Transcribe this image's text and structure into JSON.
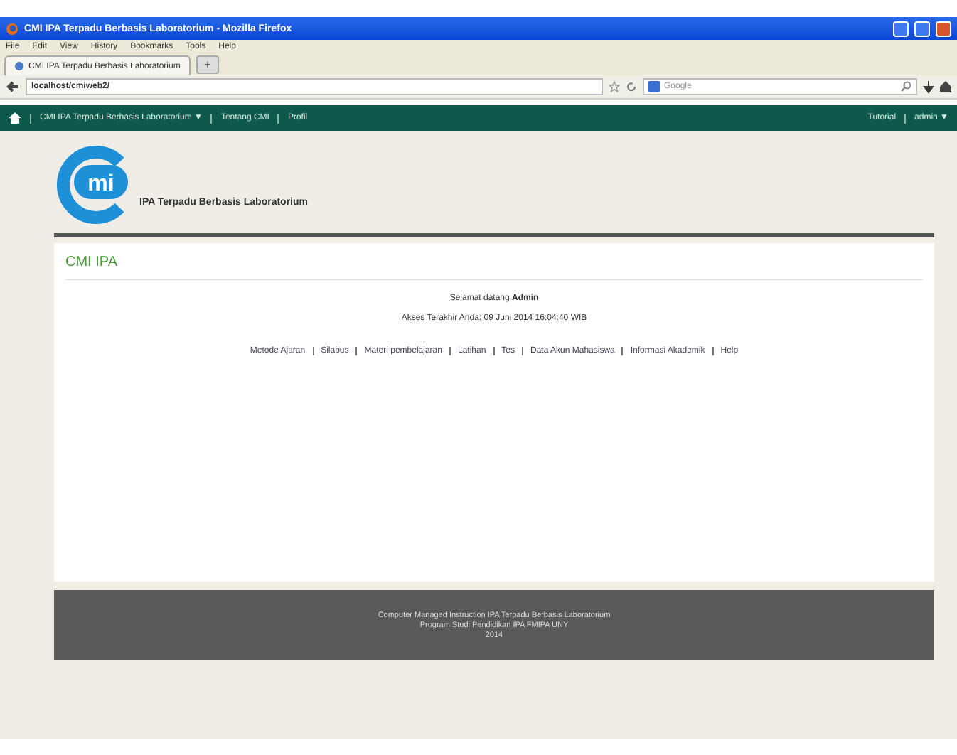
{
  "window": {
    "title": "CMI IPA Terpadu Berbasis Laboratorium - Mozilla Firefox"
  },
  "menu": [
    "File",
    "Edit",
    "View",
    "History",
    "Bookmarks",
    "Tools",
    "Help"
  ],
  "tabs": [
    {
      "label": "CMI IPA Terpadu Berbasis Laboratorium",
      "selected": true
    }
  ],
  "new_tab": "+",
  "address": {
    "value": "localhost/cmiweb2/"
  },
  "search": {
    "placeholder": "Google"
  },
  "navbar": {
    "items": [
      {
        "label": "CMI IPA Terpadu Berbasis Laboratorium ▼"
      },
      {
        "label": "Tentang CMI"
      },
      {
        "label": "Profil"
      }
    ],
    "right": [
      {
        "label": "Tutorial"
      },
      {
        "label": "admin ▼"
      }
    ]
  },
  "logo": {
    "mark": "mi",
    "subtitle": "IPA Terpadu Berbasis Laboratorium"
  },
  "content": {
    "heading": "CMI IPA",
    "welcome": "Selamat datang **Admin**",
    "last_access": "Akses Terakhir Anda: 09 Juni 2014 16:04:40 WIB",
    "links": [
      "Metode Ajaran",
      "Silabus",
      "Materi pembelajaran",
      "Latihan",
      "Tes",
      "Data Akun Mahasiswa",
      "Informasi Akademik",
      "Help"
    ]
  },
  "footer": [
    "Computer Managed Instruction IPA Terpadu Berbasis Laboratorium",
    "Program Studi Pendidikan IPA FMIPA UNY",
    "2014"
  ]
}
